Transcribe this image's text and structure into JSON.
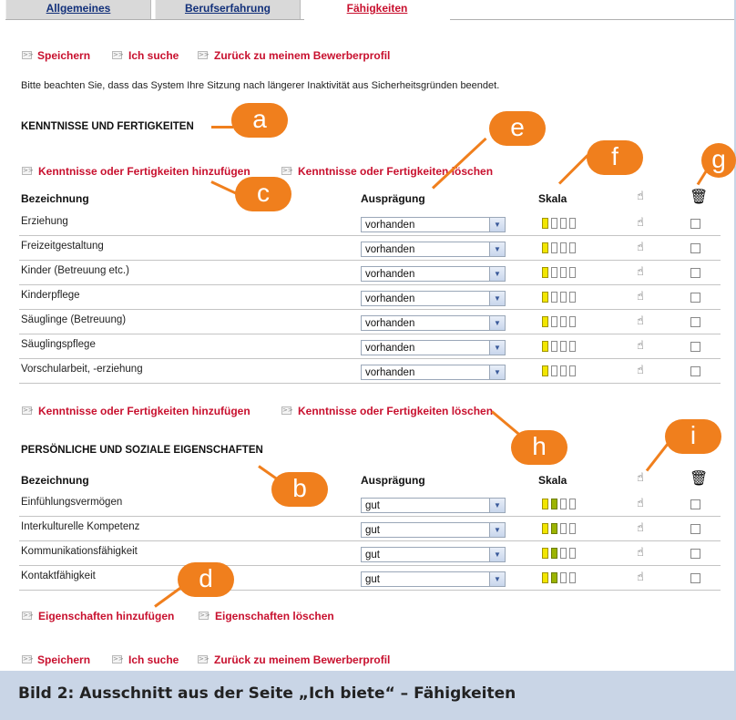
{
  "tabs": [
    {
      "label": "Allgemeines"
    },
    {
      "label": "Berufserfahrung"
    },
    {
      "label": "Fähigkeiten"
    }
  ],
  "top_actions": {
    "save": "Speichern",
    "search": "Ich suche",
    "back": "Zurück zu meinem Bewerberprofil"
  },
  "notice": "Bitte beachten Sie, dass das System Ihre Sitzung nach längerer Inaktivität aus Sicherheitsgründen beendet.",
  "skills": {
    "heading": "KENNTNISSE UND FERTIGKEITEN",
    "add": "Kenntnisse oder Fertigkeiten hinzufügen",
    "delete": "Kenntnisse oder Fertigkeiten löschen",
    "columns": {
      "name": "Bezeichnung",
      "level": "Ausprägung",
      "scale": "Skala"
    },
    "rows": [
      {
        "name": "Erziehung",
        "level": "vorhanden",
        "scale": 1
      },
      {
        "name": "Freizeitgestaltung",
        "level": "vorhanden",
        "scale": 1
      },
      {
        "name": "Kinder (Betreuung etc.)",
        "level": "vorhanden",
        "scale": 1
      },
      {
        "name": "Kinderpflege",
        "level": "vorhanden",
        "scale": 1
      },
      {
        "name": "Säuglinge (Betreuung)",
        "level": "vorhanden",
        "scale": 1
      },
      {
        "name": "Säuglingspflege",
        "level": "vorhanden",
        "scale": 1
      },
      {
        "name": "Vorschularbeit, -erziehung",
        "level": "vorhanden",
        "scale": 1
      }
    ]
  },
  "traits": {
    "heading": "PERSÖNLICHE UND SOZIALE EIGENSCHAFTEN",
    "add": "Eigenschaften hinzufügen",
    "delete": "Eigenschaften löschen",
    "columns": {
      "name": "Bezeichnung",
      "level": "Ausprägung",
      "scale": "Skala"
    },
    "rows": [
      {
        "name": "Einfühlungsvermögen",
        "level": "gut",
        "scale": 2
      },
      {
        "name": "Interkulturelle Kompetenz",
        "level": "gut",
        "scale": 2
      },
      {
        "name": "Kommunikationsfähigkeit",
        "level": "gut",
        "scale": 2
      },
      {
        "name": "Kontaktfähigkeit",
        "level": "gut",
        "scale": 2
      }
    ]
  },
  "bottom_actions": {
    "save": "Speichern",
    "search": "Ich suche",
    "back": "Zurück zu meinem Bewerberprofil"
  },
  "annotations": {
    "a": "a",
    "b": "b",
    "c": "c",
    "d": "d",
    "e": "e",
    "f": "f",
    "g": "g",
    "h": "h",
    "i": "i"
  },
  "icons": {
    "arrow": "double-chevron-right-icon",
    "edit": "hand-pointer-icon",
    "delete": "trash-icon"
  },
  "colors": {
    "link": "#c8102e",
    "annotation": "#f07f1d",
    "scale_level_1": "#f2e600",
    "scale_level_2": "#9cb400"
  },
  "caption": "Bild 2: Ausschnitt aus der Seite „Ich biete“ – Fähigkeiten"
}
